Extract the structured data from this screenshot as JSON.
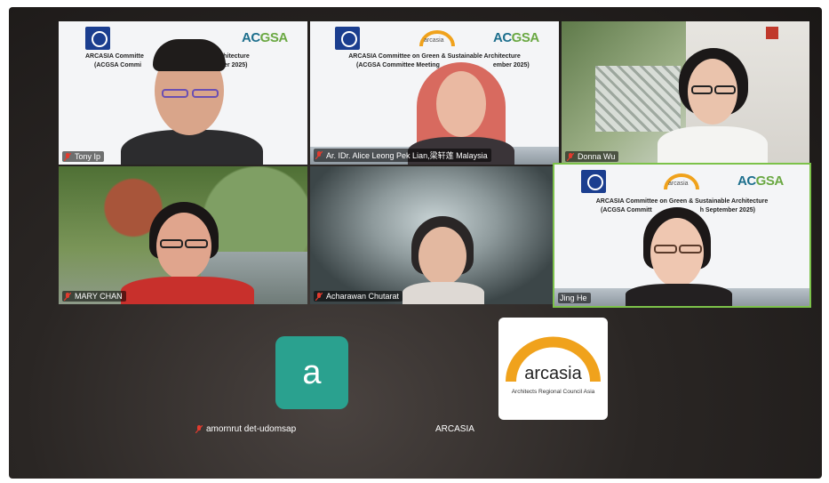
{
  "participants": [
    {
      "name": "Tony Ip"
    },
    {
      "name": "Ar. IDr. Alice Leong Pek Lian,梁轩莲 Malaysia"
    },
    {
      "name": "Donna Wu"
    },
    {
      "name": "MARY CHAN"
    },
    {
      "name": "Acharawan Chutarat"
    },
    {
      "name": "Jing He"
    }
  ],
  "banner": {
    "line1_a": "ARCASIA Committe",
    "line1_a_tail": "able Architecture",
    "line2_a": "(ACGSA Commi",
    "line2_a_tail": "ptember 2025)",
    "line1_b": "ARCASIA Committee on Green & Sustainable Architecture",
    "line2_b": "(ACGSA Committee Meeting",
    "line2_b_tail": "ember 2025)",
    "line1_c": "ARCASIA Committee on Green & Sustainable Architecture",
    "line2_c": "(ACGSA Committ",
    "line2_c_tail": "h September 2025)",
    "acgsa": "ACGSA",
    "arcasia_small": "arcasia"
  },
  "bottom": {
    "avatar_letter": "a",
    "avatar_name": "amornrut det-udomsap",
    "logo_name": "ARCASIA",
    "logo_word": "arcasia",
    "logo_sub": "Architects Regional Council Asia"
  },
  "colors": {
    "accent_teal": "#2aa18f",
    "muted_mic": "#e23b2e",
    "arc_orange": "#f0a21c"
  }
}
